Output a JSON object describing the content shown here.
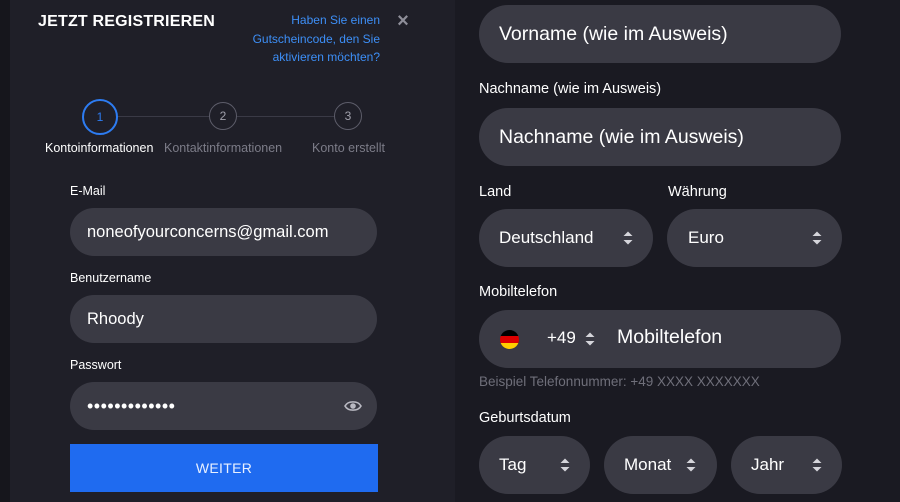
{
  "left": {
    "title": "JETZT REGISTRIEREN",
    "voucher_link_line1": "Haben Sie einen",
    "voucher_link_line2": "Gutscheincode, den Sie",
    "voucher_link_line3": "aktivieren möchten?",
    "close_symbol": "×",
    "steps": [
      {
        "number": "1",
        "label": "Kontoinformationen",
        "active": true
      },
      {
        "number": "2",
        "label": "Kontaktinformationen",
        "active": false
      },
      {
        "number": "3",
        "label": "Konto erstellt",
        "active": false
      }
    ],
    "email_label": "E-Mail",
    "email_value": "noneofyourconcerns@gmail.com",
    "username_label": "Benutzername",
    "username_value": "Rhoody",
    "password_label": "Passwort",
    "password_value": "•••••••••••••",
    "submit_label": "WEITER"
  },
  "right": {
    "firstname_placeholder": "Vorname (wie im Ausweis)",
    "lastname_label": "Nachname (wie im Ausweis)",
    "lastname_placeholder": "Nachname (wie im Ausweis)",
    "country_label": "Land",
    "country_value": "Deutschland",
    "currency_label": "Währung",
    "currency_value": "Euro",
    "mobile_label": "Mobiltelefon",
    "mobile_country_code": "+49",
    "mobile_placeholder": "Mobiltelefon",
    "mobile_hint": "Beispiel Telefonnummer: +49 XXXX XXXXXXX",
    "birthdate_label": "Geburtsdatum",
    "day_placeholder": "Tag",
    "month_placeholder": "Monat",
    "year_placeholder": "Jahr"
  },
  "colors": {
    "accent": "#1f6bf0",
    "link": "#3d8ff7",
    "input_bg": "#3a3a44",
    "panel_bg": "#1f1f28"
  }
}
